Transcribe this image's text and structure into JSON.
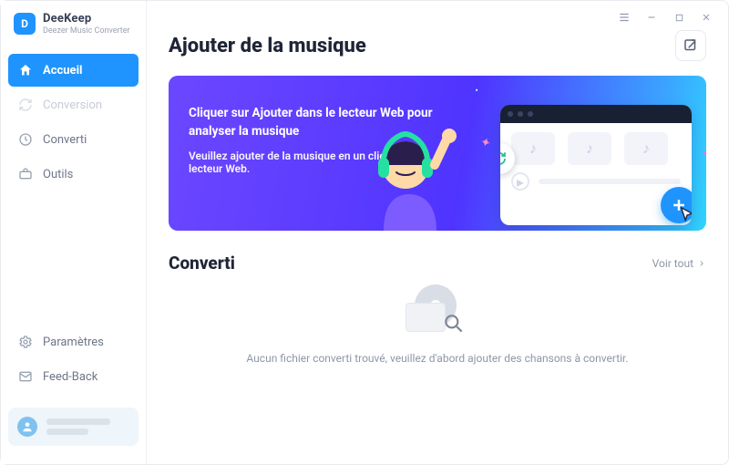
{
  "brand": {
    "name": "DeeKeep",
    "subtitle": "Deezer Music Converter"
  },
  "sidebar": {
    "items": [
      {
        "label": "Accueil"
      },
      {
        "label": "Conversion"
      },
      {
        "label": "Converti"
      },
      {
        "label": "Outils"
      }
    ],
    "bottom": [
      {
        "label": "Paramètres"
      },
      {
        "label": "Feed-Back"
      }
    ]
  },
  "titlebar": {
    "menu": "≡",
    "min": "—",
    "max": "□",
    "close": "✕"
  },
  "add_music": {
    "title": "Ajouter de la musique",
    "open_player_tip": "Ouvrir le lecteur",
    "banner_bold": "Cliquer sur Ajouter dans le lecteur Web pour analyser la musique",
    "banner_sub": "Veuillez ajouter de la musique en un clic dans le lecteur Web."
  },
  "converted": {
    "title": "Converti",
    "see_all": "Voir tout",
    "empty_msg": "Aucun fichier converti trouvé, veuillez d'abord ajouter des chansons à convertir."
  }
}
